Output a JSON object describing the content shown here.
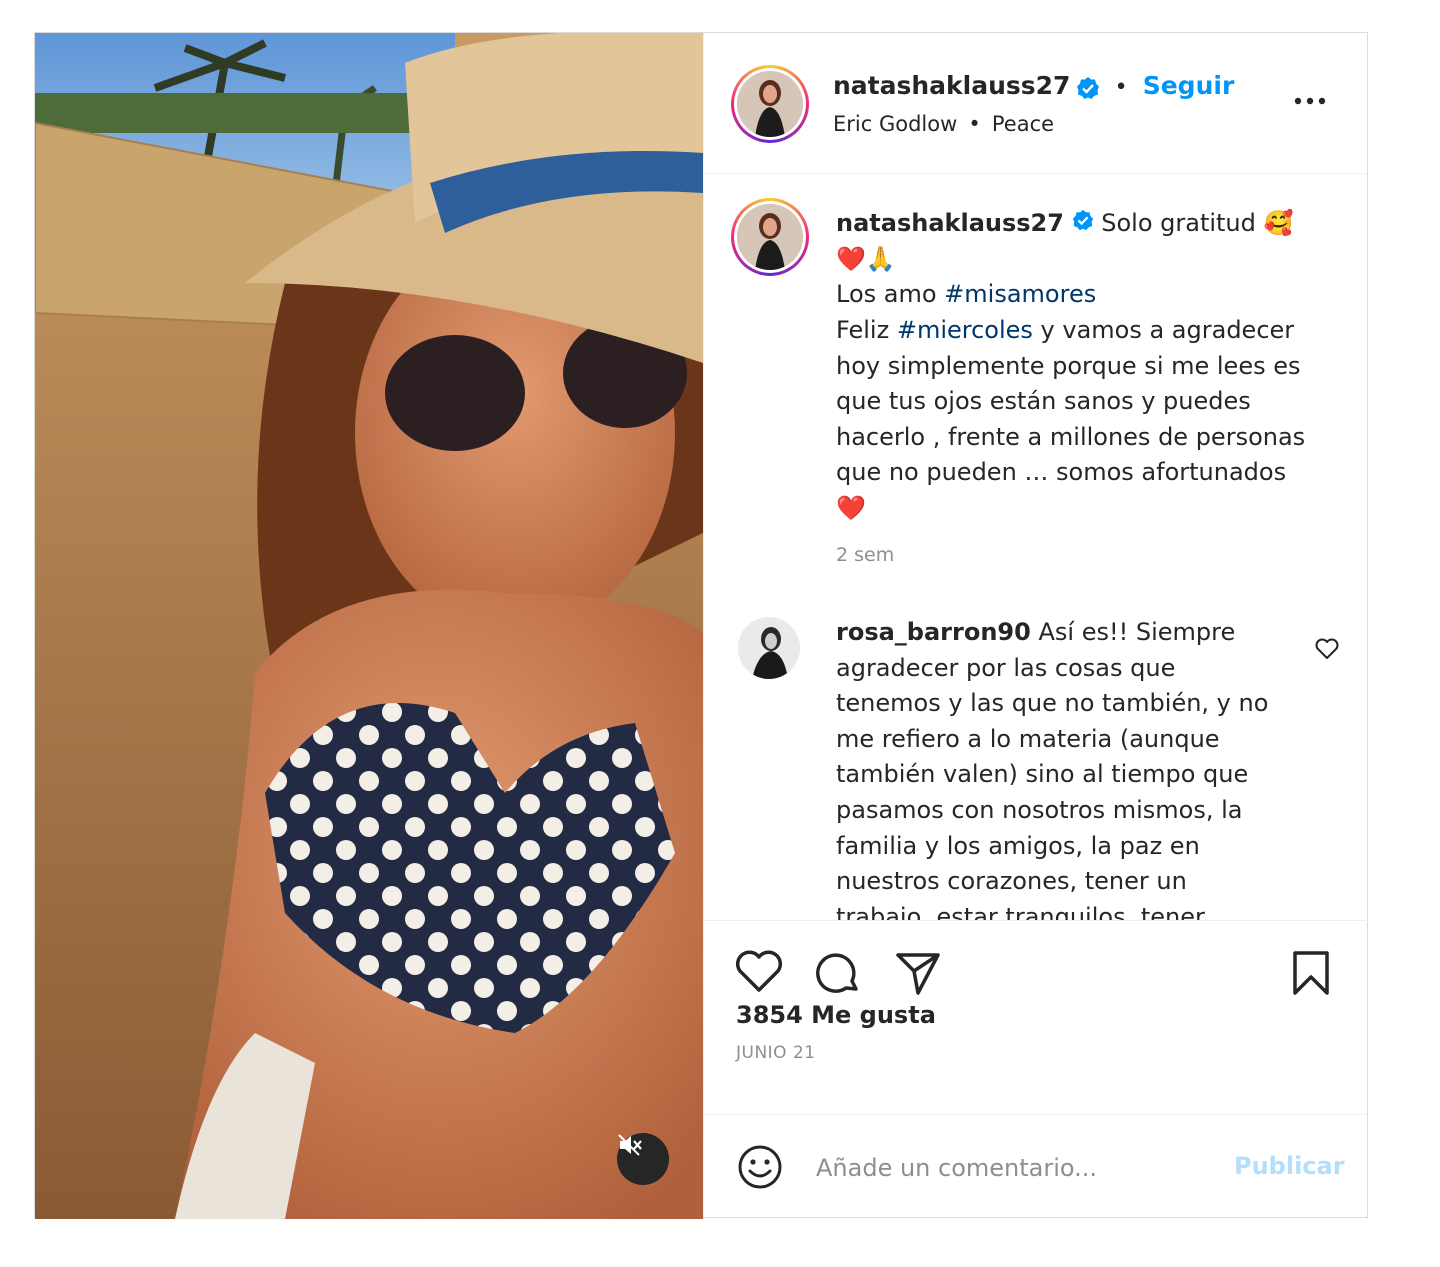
{
  "post": {
    "username": "natashaklauss27",
    "follow_label": "Seguir",
    "separator": "•",
    "audio_artist": "Eric Godlow",
    "audio_separator": "•",
    "audio_title": "Peace",
    "more_icon": "more-options-icon",
    "verified_color": "#0095f6"
  },
  "caption": {
    "username": "natashaklauss27",
    "line1": "Solo gratitud 🥰",
    "line2": "❤️🙏",
    "line3_text": "Los amo ",
    "line3_tag": "#misamores",
    "line4_text": "Feliz ",
    "line4_tag": "#miercoles",
    "line4_rest": " y vamos a agradecer",
    "line5": "hoy simplemente porque si me lees es",
    "line6": "que tus ojos están sanos y puedes",
    "line7": "hacerlo , frente a millones de personas",
    "line8": "que no pueden … somos afortunados",
    "line9": "❤️",
    "time": "2 sem"
  },
  "comment": {
    "username": "rosa_barron90",
    "lines": [
      "Así es!! Siempre",
      "agradecer por las cosas que",
      "tenemos y las que no también, y no",
      "me refiero a lo materia (aunque",
      "también valen) sino al tiempo que",
      "pasamos con nosotros mismos, la",
      "familia y los amigos, la paz en",
      "nuestros corazones, tener un",
      "trabajo, estar tranquilos, tener"
    ]
  },
  "actions": {
    "likes": "3854 Me gusta",
    "date": "JUNIO 21"
  },
  "add_comment": {
    "placeholder": "Añade un comentario...",
    "publish_label": "Publicar"
  },
  "colors": {
    "link_blue": "#0095f6",
    "hashtag": "#00376b",
    "muted": "#8e8e8e"
  }
}
